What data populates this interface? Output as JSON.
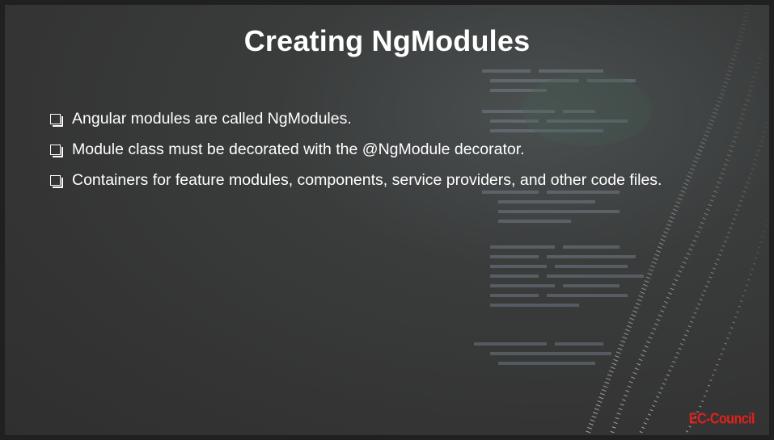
{
  "slide": {
    "title": "Creating NgModules",
    "bullets": [
      "Angular modules are called NgModules.",
      "Module class must be decorated with the @NgModule decorator.",
      "Containers for feature modules, components, service providers, and other code files."
    ],
    "bullet_icon": "checkbox-square-icon",
    "logo_text": "EC-Council"
  },
  "colors": {
    "background": "#343434",
    "text": "#ffffff",
    "logo": "#e3201b"
  }
}
